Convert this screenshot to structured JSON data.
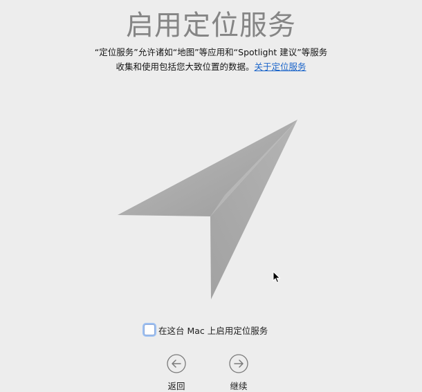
{
  "title": "启用定位服务",
  "description": {
    "line1": "“定位服务”允许诸如“地图”等应用和“Spotlight 建议”等服务",
    "line2": "收集和使用包括您大致位置的数据。",
    "link": "关于定位服务"
  },
  "hero_icon": "location-arrow-icon",
  "checkbox": {
    "label": "在这台 Mac 上启用定位服务",
    "checked": false
  },
  "navigation": {
    "back_label": "返回",
    "back_icon": "arrow-left-circle-icon",
    "continue_label": "继续",
    "continue_icon": "arrow-right-circle-icon"
  },
  "colors": {
    "background": "#ededed",
    "title": "#858585",
    "link": "#1a64c9",
    "arrow": "#a8a8a8"
  }
}
